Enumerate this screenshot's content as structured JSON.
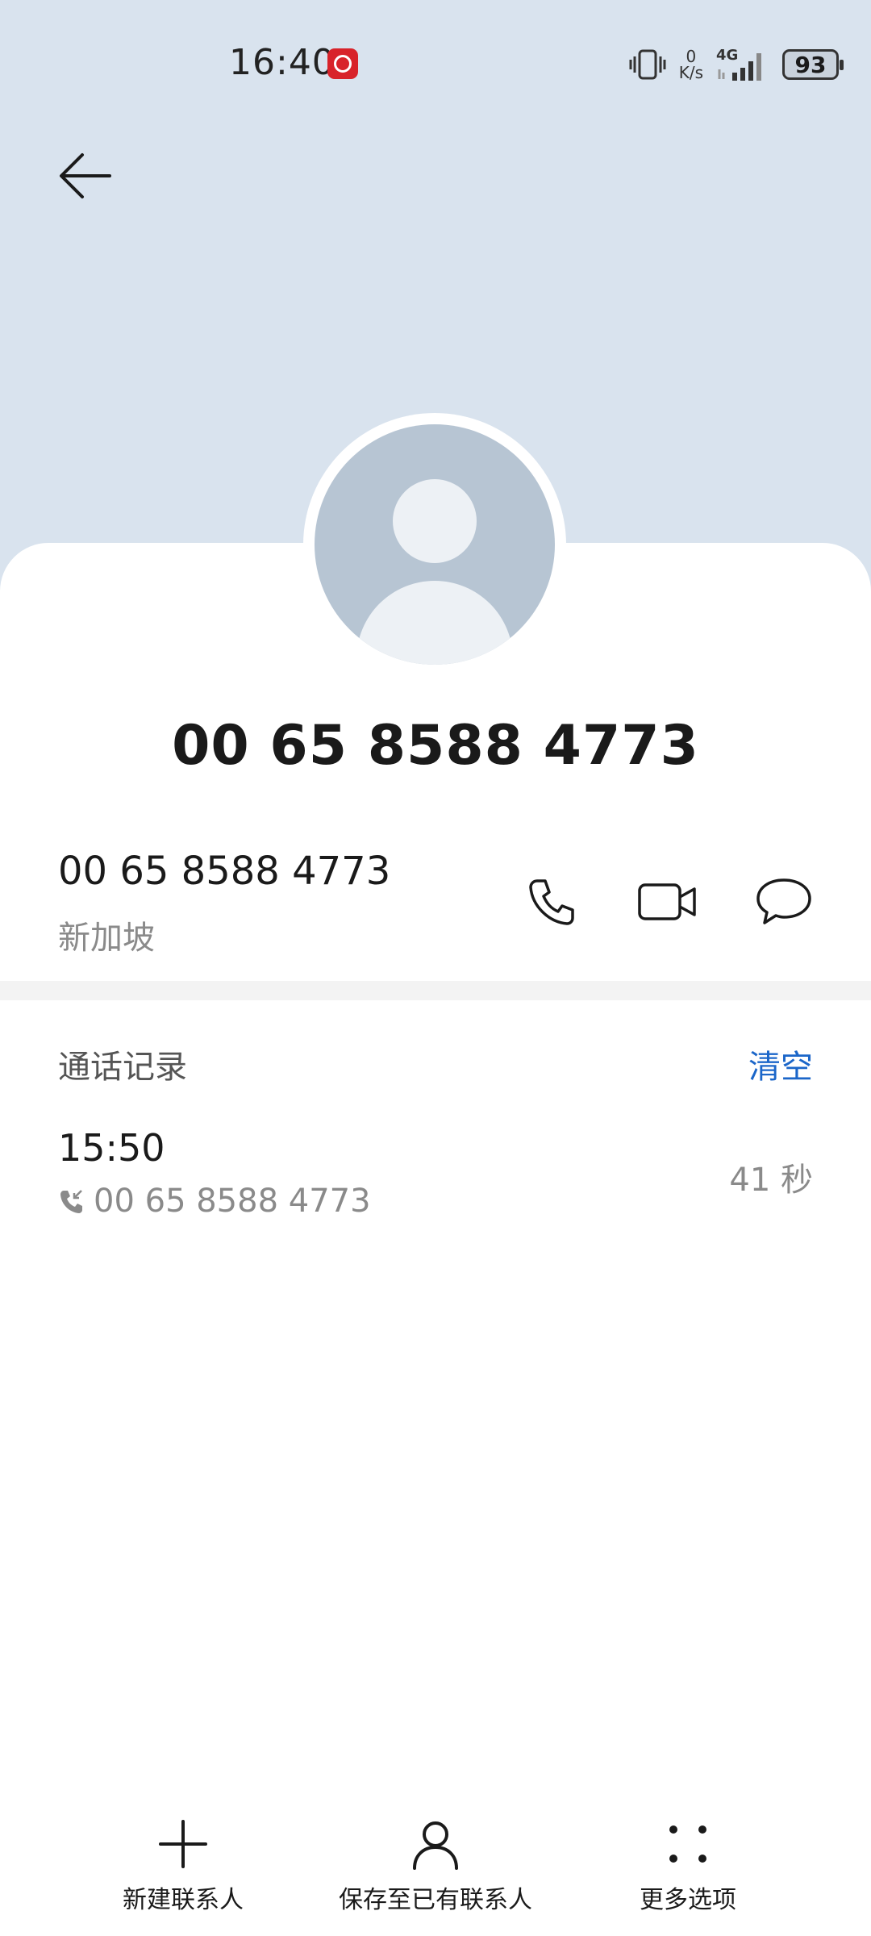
{
  "status_bar": {
    "time": "16:40",
    "net_speed_value": "0",
    "net_speed_unit": "K/s",
    "network": "4G",
    "battery": "93",
    "icons": [
      "app-notification-icon",
      "vibrate-icon",
      "signal-icon",
      "battery-icon"
    ]
  },
  "header": {
    "back_icon": "arrow-left-icon"
  },
  "contact": {
    "title": "00 65 8588 4773",
    "number": "00 65 8588 4773",
    "region": "新加坡",
    "actions": [
      "phone-icon",
      "video-call-icon",
      "message-icon"
    ]
  },
  "call_log": {
    "heading": "通话记录",
    "clear_label": "清空",
    "entries": [
      {
        "time": "15:50",
        "number": "00 65 8588 4773",
        "duration": "41 秒",
        "direction_icon": "incoming-call-icon"
      }
    ]
  },
  "bottom_bar": {
    "items": [
      {
        "label": "新建联系人",
        "icon": "plus-icon"
      },
      {
        "label": "保存至已有联系人",
        "icon": "person-icon"
      },
      {
        "label": "更多选项",
        "icon": "more-dots-icon"
      }
    ]
  },
  "colors": {
    "header_bg": "#d9e3ee",
    "accent": "#1b66c9",
    "avatar_bg": "#b7c5d3",
    "app_badge": "#d8232a"
  }
}
